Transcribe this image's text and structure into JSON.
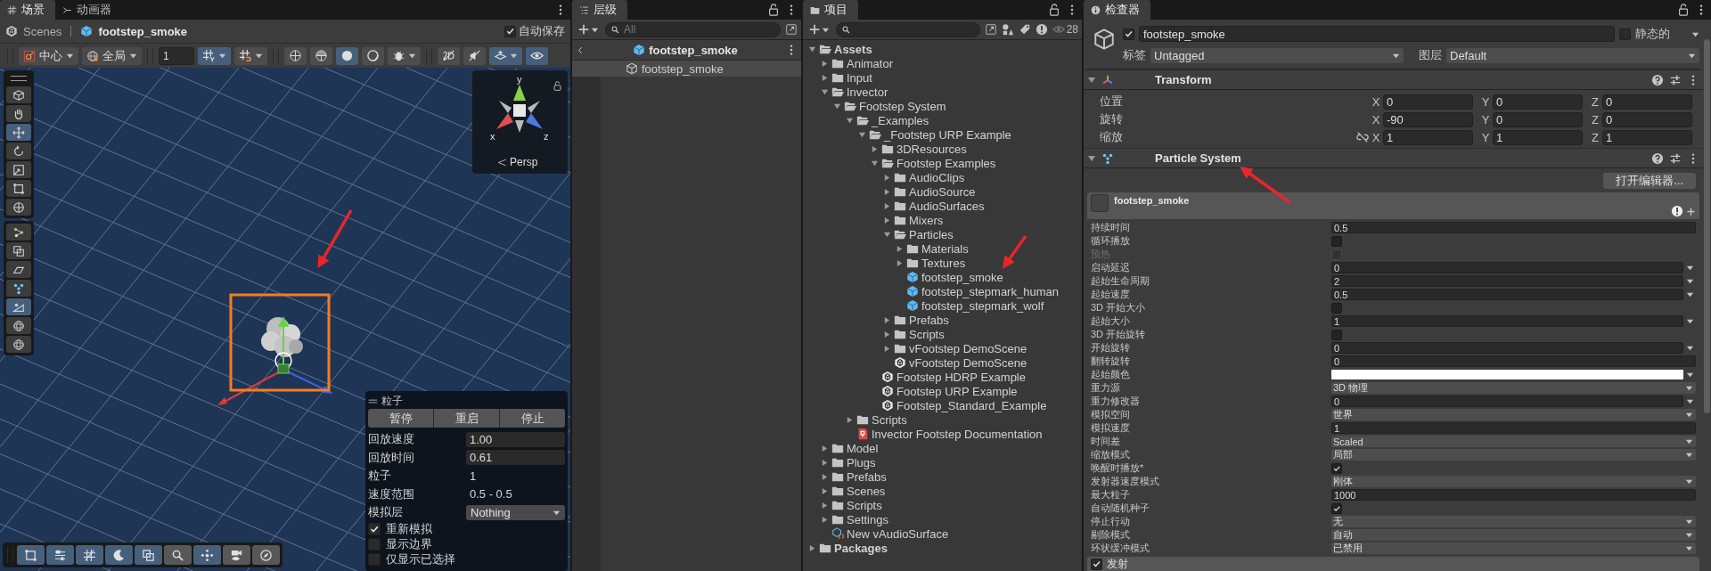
{
  "scene_panel": {
    "tabs": [
      {
        "label": "场景",
        "kind": "grid",
        "selected": true
      },
      {
        "label": "动画器",
        "kind": "animator",
        "selected": false
      }
    ],
    "breadcrumb": [
      "Scenes",
      "footstep_smoke"
    ],
    "auto_save": {
      "label": "自动保存",
      "checked": true
    },
    "toolbar": {
      "pivot": "中心",
      "space": "全局",
      "grid_size": "1",
      "buttons": [
        {
          "kind": "grid-snap",
          "on": true,
          "dropdown": true
        },
        {
          "kind": "grid-move",
          "on": false,
          "dropdown": true
        },
        {
          "kind": "wire",
          "on": false,
          "dropdown": false
        },
        {
          "kind": "shaded-wire",
          "on": false,
          "dropdown": false
        },
        {
          "kind": "shaded",
          "on": true,
          "dropdown": false
        },
        {
          "kind": "unlit",
          "on": false,
          "dropdown": false
        },
        {
          "kind": "bug",
          "on": false,
          "dropdown": true
        },
        {
          "kind": "flat",
          "on": false,
          "dropdown": false
        },
        {
          "kind": "audio",
          "on": false,
          "dropdown": false
        },
        {
          "kind": "effects",
          "on": true,
          "dropdown": true
        },
        {
          "kind": "eye",
          "on": true,
          "dropdown": false
        }
      ]
    },
    "tools": [
      {
        "kind": "view",
        "selected": false
      },
      {
        "kind": "hand",
        "selected": false
      },
      {
        "kind": "move",
        "selected": true
      },
      {
        "kind": "rotate",
        "selected": false
      },
      {
        "kind": "scale",
        "selected": false
      },
      {
        "kind": "rect",
        "selected": false
      },
      {
        "kind": "transform",
        "selected": false
      }
    ],
    "custom_tools": [
      {
        "kind": "vertex",
        "selected": false
      },
      {
        "kind": "layers",
        "selected": false
      },
      {
        "kind": "plane",
        "selected": false
      },
      {
        "kind": "particle",
        "selected": false
      },
      {
        "kind": "slope",
        "selected": true
      },
      {
        "kind": "sphere",
        "selected": false
      },
      {
        "kind": "sphere",
        "selected": false
      }
    ],
    "gizmo": {
      "axes": [
        "y",
        "x",
        "z"
      ],
      "projection": "Persp"
    },
    "particle_overlay": {
      "title": "粒子",
      "buttons": [
        "暂停",
        "重启",
        "停止"
      ],
      "stats": [
        {
          "label": "回放速度",
          "value": "1.00",
          "kind": "field"
        },
        {
          "label": "回放时间",
          "value": "0.61",
          "kind": "field"
        },
        {
          "label": "粒子",
          "value": "1",
          "kind": "text"
        },
        {
          "label": "速度范围",
          "value": "0.5 - 0.5",
          "kind": "text"
        },
        {
          "label": "模拟层",
          "value": "Nothing",
          "kind": "select"
        }
      ],
      "options": [
        {
          "label": "重新模拟",
          "checked": true
        },
        {
          "label": "显示边界",
          "checked": false
        },
        {
          "label": "仅显示已选择",
          "checked": false
        }
      ]
    },
    "bottom_toolbar": [
      {
        "kind": "rect",
        "on": true
      },
      {
        "kind": "sliders",
        "on": true
      },
      {
        "kind": "grid",
        "on": true
      },
      {
        "kind": "moon",
        "on": true
      },
      {
        "kind": "layers",
        "on": true
      },
      {
        "kind": "search",
        "on": false
      },
      {
        "kind": "move-dots",
        "on": true
      },
      {
        "kind": "camera",
        "on": false
      },
      {
        "kind": "compass",
        "on": false
      }
    ]
  },
  "hierarchy": {
    "title": "层级",
    "search": {
      "placeholder": "All"
    },
    "prefab_header": "footstep_smoke",
    "items": [
      {
        "label": "footstep_smoke",
        "selected": true
      }
    ]
  },
  "project": {
    "title": "项目",
    "hidden_count": "28",
    "tree": [
      {
        "label": "Assets",
        "kind": "folder",
        "expanded": true,
        "children": [
          {
            "label": "Animator",
            "kind": "folder",
            "expanded": false
          },
          {
            "label": "Input",
            "kind": "folder",
            "expanded": false
          },
          {
            "label": "Invector",
            "kind": "folder",
            "expanded": true,
            "children": [
              {
                "label": "Footstep System",
                "kind": "folder",
                "expanded": true,
                "children": [
                  {
                    "label": "_Examples",
                    "kind": "folder",
                    "expanded": true,
                    "children": [
                      {
                        "label": "_Footstep URP Example",
                        "kind": "folder",
                        "expanded": true,
                        "children": [
                          {
                            "label": "3DResources",
                            "kind": "folder",
                            "expanded": false
                          },
                          {
                            "label": "Footstep Examples",
                            "kind": "folder",
                            "expanded": true,
                            "children": [
                              {
                                "label": "AudioClips",
                                "kind": "folder",
                                "expanded": false
                              },
                              {
                                "label": "AudioSource",
                                "kind": "folder",
                                "expanded": false
                              },
                              {
                                "label": "AudioSurfaces",
                                "kind": "folder",
                                "expanded": false
                              },
                              {
                                "label": "Mixers",
                                "kind": "folder",
                                "expanded": false
                              },
                              {
                                "label": "Particles",
                                "kind": "folder",
                                "expanded": true,
                                "children": [
                                  {
                                    "label": "Materials",
                                    "kind": "folder",
                                    "expanded": false
                                  },
                                  {
                                    "label": "Textures",
                                    "kind": "folder",
                                    "expanded": false
                                  },
                                  {
                                    "label": "footstep_smoke",
                                    "kind": "prefab"
                                  },
                                  {
                                    "label": "footstep_stepmark_human",
                                    "kind": "prefab"
                                  },
                                  {
                                    "label": "footstep_stepmark_wolf",
                                    "kind": "prefab"
                                  }
                                ]
                              },
                              {
                                "label": "Prefabs",
                                "kind": "folder",
                                "expanded": false
                              },
                              {
                                "label": "Scripts",
                                "kind": "folder",
                                "expanded": false
                              },
                              {
                                "label": "vFootstep DemoScene",
                                "kind": "folder",
                                "expanded": false
                              },
                              {
                                "label": "vFootstep DemoScene",
                                "kind": "scene"
                              }
                            ]
                          },
                          {
                            "label": "Footstep HDRP Example",
                            "kind": "scene"
                          },
                          {
                            "label": "Footstep URP Example",
                            "kind": "scene"
                          },
                          {
                            "label": "Footstep_Standard_Example",
                            "kind": "scene"
                          }
                        ]
                      }
                    ]
                  },
                  {
                    "label": "Scripts",
                    "kind": "folder",
                    "expanded": false
                  },
                  {
                    "label": "Invector Footstep Documentation",
                    "kind": "document"
                  }
                ]
              }
            ]
          },
          {
            "label": "Model",
            "kind": "folder",
            "expanded": false
          },
          {
            "label": "Plugs",
            "kind": "folder",
            "expanded": false
          },
          {
            "label": "Prefabs",
            "kind": "folder",
            "expanded": false
          },
          {
            "label": "Scenes",
            "kind": "folder",
            "expanded": false
          },
          {
            "label": "Scripts",
            "kind": "folder",
            "expanded": false
          },
          {
            "label": "Settings",
            "kind": "folder",
            "expanded": false
          },
          {
            "label": "New vAudioSurface",
            "kind": "asset"
          }
        ]
      },
      {
        "label": "Packages",
        "kind": "folder",
        "expanded": false
      }
    ]
  },
  "inspector": {
    "title": "检查器",
    "object": {
      "name": "footstep_smoke",
      "active": true,
      "static": {
        "label": "静态的",
        "checked": false
      },
      "tag": {
        "label": "标签",
        "value": "Untagged"
      },
      "layer": {
        "label": "图层",
        "value": "Default"
      }
    },
    "transform": {
      "title": "Transform",
      "expanded": true,
      "rows": [
        {
          "label": "位置",
          "linked": false,
          "values": [
            {
              "axis": "X",
              "value": "0"
            },
            {
              "axis": "Y",
              "value": "0"
            },
            {
              "axis": "Z",
              "value": "0"
            }
          ]
        },
        {
          "label": "旋转",
          "linked": false,
          "values": [
            {
              "axis": "X",
              "value": "-90"
            },
            {
              "axis": "Y",
              "value": "0"
            },
            {
              "axis": "Z",
              "value": "0"
            }
          ]
        },
        {
          "label": "缩放",
          "linked": true,
          "values": [
            {
              "axis": "X",
              "value": "1"
            },
            {
              "axis": "Y",
              "value": "1"
            },
            {
              "axis": "Z",
              "value": "1"
            }
          ]
        }
      ]
    },
    "particle_system": {
      "title": "Particle System",
      "expanded": true,
      "open_editor": "打开编辑器...",
      "module_title": "footstep_smoke",
      "properties": [
        {
          "label": "持续时间",
          "kind": "field",
          "value": "0.5",
          "disabled": false
        },
        {
          "label": "循环播放",
          "kind": "checkbox",
          "checked": false,
          "disabled": false
        },
        {
          "label": "预热",
          "kind": "checkbox",
          "checked": false,
          "disabled": true
        },
        {
          "label": "启动延迟",
          "kind": "curve",
          "value": "0",
          "disabled": false
        },
        {
          "label": "起始生命周期",
          "kind": "curve",
          "value": "2",
          "disabled": false
        },
        {
          "label": "起始速度",
          "kind": "curve",
          "value": "0.5",
          "disabled": false
        },
        {
          "label": "3D 开始大小",
          "kind": "checkbox",
          "checked": false,
          "disabled": false
        },
        {
          "label": "起始大小",
          "kind": "curve",
          "value": "1",
          "disabled": false
        },
        {
          "label": "3D 开始旋转",
          "kind": "checkbox",
          "checked": false,
          "disabled": false
        },
        {
          "label": "开始旋转",
          "kind": "curve",
          "value": "0",
          "disabled": false
        },
        {
          "label": "翻转旋转",
          "kind": "field",
          "value": "0",
          "disabled": false
        },
        {
          "label": "起始颜色",
          "kind": "color",
          "color": "#ffffff",
          "disabled": false
        },
        {
          "label": "重力源",
          "kind": "select",
          "value": "3D 物理",
          "disabled": false
        },
        {
          "label": "重力修改器",
          "kind": "curve",
          "value": "0",
          "disabled": false
        },
        {
          "label": "模拟空间",
          "kind": "select",
          "value": "世界",
          "disabled": false
        },
        {
          "label": "模拟速度",
          "kind": "field",
          "value": "1",
          "disabled": false
        },
        {
          "label": "时间差",
          "kind": "select",
          "value": "Scaled",
          "disabled": false
        },
        {
          "label": "缩放模式",
          "kind": "select",
          "value": "局部",
          "disabled": false
        },
        {
          "label": "唤醒时播放*",
          "kind": "checkbox",
          "checked": true,
          "disabled": false
        },
        {
          "label": "发射器速度模式",
          "kind": "select",
          "value": "刚体",
          "disabled": false
        },
        {
          "label": "最大粒子",
          "kind": "field",
          "value": "1000",
          "disabled": false
        },
        {
          "label": "自动随机种子",
          "kind": "checkbox",
          "checked": true,
          "disabled": false
        },
        {
          "label": "停止行动",
          "kind": "select",
          "value": "无",
          "disabled": false
        },
        {
          "label": "剔除模式",
          "kind": "select",
          "value": "自动",
          "disabled": false
        },
        {
          "label": "环状缓冲模式",
          "kind": "select",
          "value": "已禁用",
          "disabled": false
        }
      ],
      "emission": {
        "label": "发射",
        "checked": true
      }
    }
  }
}
